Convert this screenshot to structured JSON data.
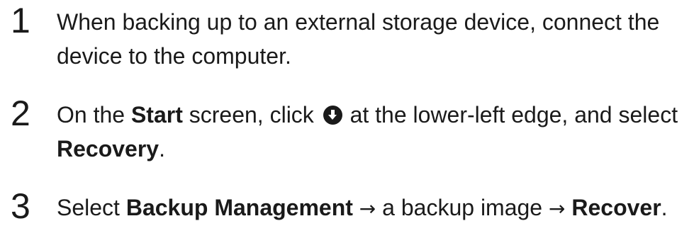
{
  "steps": [
    {
      "number": "1",
      "line1": "When backing up to an external storage device, connect the",
      "line2": "device to the computer."
    },
    {
      "number": "2",
      "t1": "On the ",
      "b1": "Start",
      "t2": " screen, click ",
      "icon": "down-arrow-circle-icon",
      "t3": " at the lower-left edge, and select",
      "b2": "Recovery",
      "t4": "."
    },
    {
      "number": "3",
      "t1": "Select ",
      "b1": "Backup Management",
      "arrow1": " → ",
      "t2": "a backup image",
      "arrow2": " → ",
      "b2": "Recover",
      "t3": "."
    }
  ]
}
